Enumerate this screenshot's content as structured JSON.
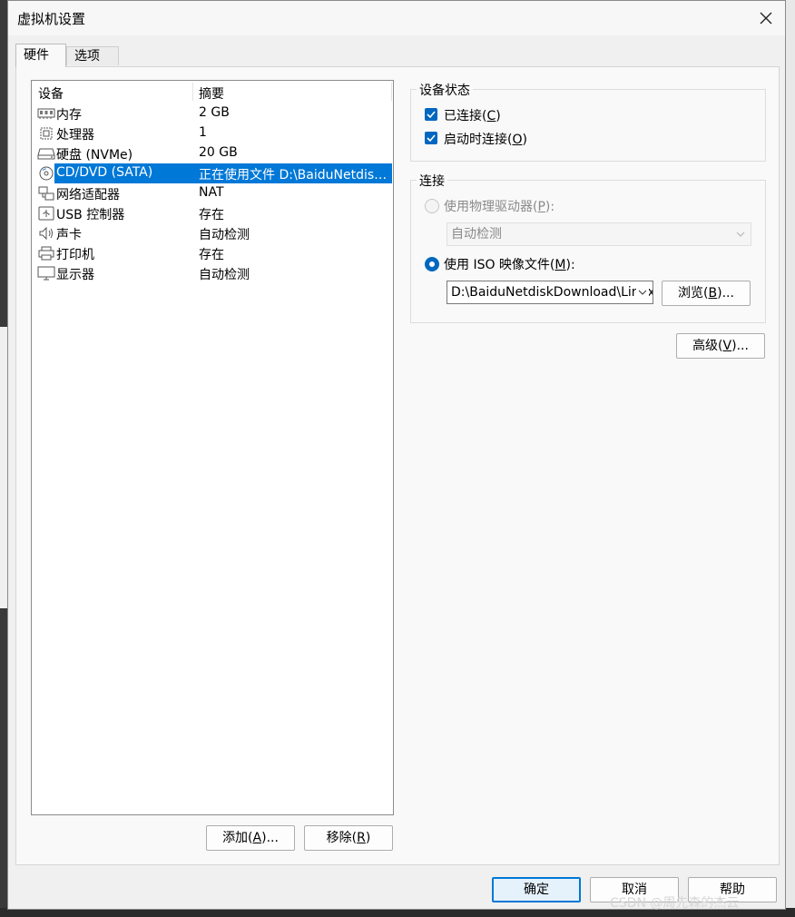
{
  "window": {
    "title": "虚拟机设置"
  },
  "tabs": [
    {
      "label": "硬件"
    },
    {
      "label": "选项"
    }
  ],
  "device_list": {
    "columns": {
      "device": "设备",
      "summary": "摘要"
    },
    "rows": [
      {
        "icon": "memory-icon",
        "name": "内存",
        "summary": "2 GB"
      },
      {
        "icon": "cpu-icon",
        "name": "处理器",
        "summary": "1"
      },
      {
        "icon": "disk-icon",
        "name": "硬盘 (NVMe)",
        "summary": "20 GB"
      },
      {
        "icon": "cd-icon",
        "name": "CD/DVD (SATA)",
        "summary": "正在使用文件 D:\\BaiduNetdisk...",
        "selected": true
      },
      {
        "icon": "network-icon",
        "name": "网络适配器",
        "summary": "NAT"
      },
      {
        "icon": "usb-icon",
        "name": "USB 控制器",
        "summary": "存在"
      },
      {
        "icon": "speaker-icon",
        "name": "声卡",
        "summary": "自动检测"
      },
      {
        "icon": "printer-icon",
        "name": "打印机",
        "summary": "存在"
      },
      {
        "icon": "monitor-icon",
        "name": "显示器",
        "summary": "自动检测"
      }
    ]
  },
  "list_buttons": {
    "add": {
      "text": "添加(",
      "key": "A",
      "tail": ")..."
    },
    "remove": {
      "text": "移除(",
      "key": "R",
      "tail": ")"
    }
  },
  "device_status": {
    "title": "设备状态",
    "connected": {
      "text": "已连接(",
      "key": "C",
      "tail": ")",
      "checked": true
    },
    "connect_on_start": {
      "text": "启动时连接(",
      "key": "O",
      "tail": ")",
      "checked": true
    }
  },
  "connection": {
    "title": "连接",
    "physical": {
      "text": "使用物理驱动器(",
      "key": "P",
      "tail": "):",
      "selected": false
    },
    "physical_value": "自动检测",
    "iso": {
      "text": "使用 ISO 映像文件(",
      "key": "M",
      "tail": "):",
      "selected": true
    },
    "iso_path": "D:\\BaiduNetdiskDownload\\Linux",
    "browse": {
      "text": "浏览(",
      "key": "B",
      "tail": ")..."
    }
  },
  "advanced": {
    "text": "高级(",
    "key": "V",
    "tail": ")..."
  },
  "footer": {
    "ok": "确定",
    "cancel": "取消",
    "help": "帮助"
  },
  "watermark": "CSDN @周先森的杰云",
  "colors": {
    "accent": "#0078d7",
    "check": "#0067c0",
    "selection": "#0078d7"
  }
}
